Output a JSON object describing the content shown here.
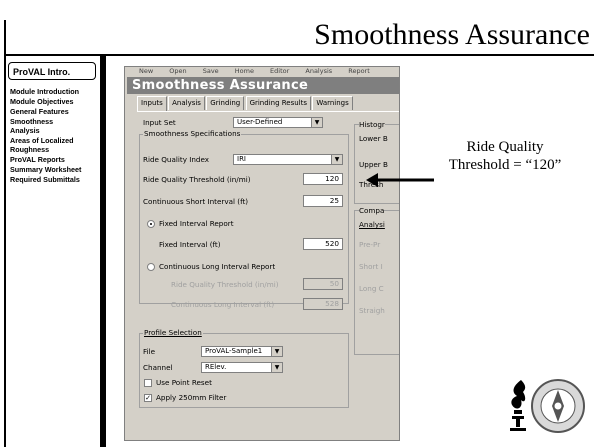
{
  "slide": {
    "title": "Smoothness Assurance"
  },
  "nav": {
    "header": "ProVAL Intro.",
    "items": [
      "Module Introduction",
      "Module Objectives",
      "General Features",
      "Smoothness\n   Analysis",
      "Areas of Localized\n   Roughness",
      "ProVAL Reports",
      "Summary Worksheet",
      "Required Submittals"
    ]
  },
  "app": {
    "menu": [
      "New",
      "Open",
      "Save",
      "Home",
      "Editor",
      "Analysis",
      "Report"
    ],
    "title": "Smoothness Assurance",
    "tabs": [
      "Inputs",
      "Analysis",
      "Grinding",
      "Grinding Results",
      "Warnings"
    ],
    "input_set_label": "Input Set",
    "input_set_value": "User-Defined",
    "spec_group_label": "Smoothness Specifications",
    "riq_label": "Ride Quality Index",
    "riq_value": "IRI",
    "rqt_label": "Ride Quality Threshold (in/mi)",
    "rqt_value": "120",
    "csi_label": "Continuous Short Interval (ft)",
    "csi_value": "25",
    "fixed_report_label": "Fixed Interval Report",
    "fixed_interval_label": "Fixed Interval (ft)",
    "fixed_interval_value": "520",
    "cont_long_label": "Continuous Long Interval Report",
    "cont_rqt_label": "Ride Quality Threshold (in/mi)",
    "cont_rqt_value": "50",
    "cont_long_interval_label": "Continuous Long Interval (ft)",
    "cont_long_interval_value": "528",
    "profile_group_label": "Profile Selection",
    "file_label": "File",
    "file_value": "ProVAL-Sample1",
    "channel_label": "Channel",
    "channel_value": "RElev.",
    "point_reset_label": "Use Point Reset",
    "filter_label": "Apply 250mm Filter",
    "right_histo": "Histogr",
    "right_lower": "Lower B",
    "right_upper": "Upper B",
    "right_thresh": "Thresh",
    "right_compare": "Compa",
    "right_analysis": "Analysi",
    "right_prepro": "Pre-Pr",
    "right_short": "Short I",
    "right_long": "Long C",
    "right_straight": "Straigh"
  },
  "annotation": {
    "text": "Ride Quality\nThreshold = “120”"
  },
  "colors": {
    "title_bar": "#7f7f7f",
    "window_bg": "#d4d0c8"
  }
}
